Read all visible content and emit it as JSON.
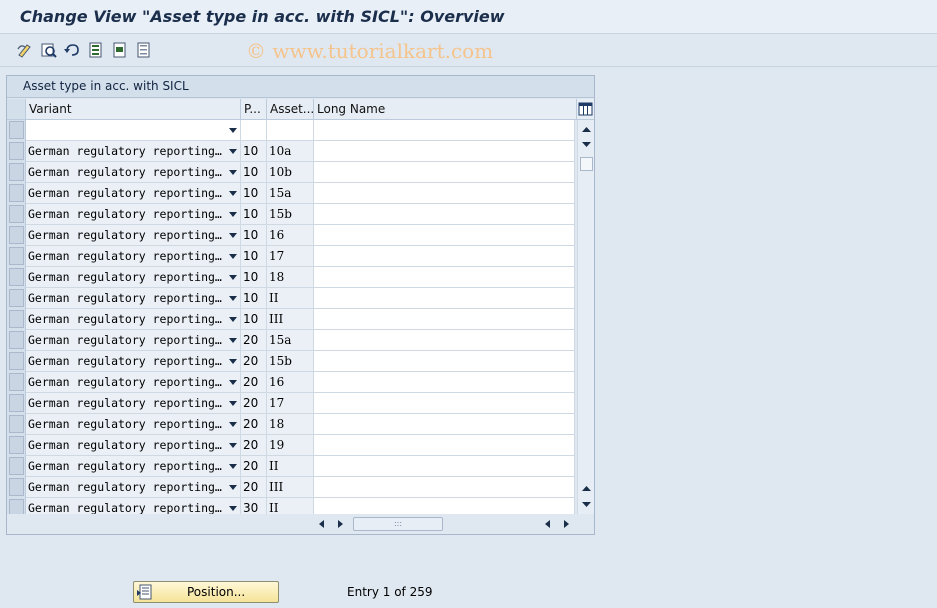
{
  "window": {
    "title": "Change View \"Asset type in acc. with SICL\": Overview"
  },
  "watermark": "© www.tutorialkart.com",
  "toolbar": {
    "icons": [
      "display-change-icon",
      "find-icon",
      "undo-icon",
      "select-all-icon",
      "select-block-icon",
      "deselect-all-icon"
    ]
  },
  "panel": {
    "title": "Asset type in acc. with SICL"
  },
  "table": {
    "columns": [
      "Variant",
      "P...",
      "Asset...",
      "Long Name"
    ],
    "rows": [
      {
        "variant": "German regulatory reporting…",
        "p": "10",
        "asset": "10a",
        "long": ""
      },
      {
        "variant": "German regulatory reporting…",
        "p": "10",
        "asset": "10b",
        "long": ""
      },
      {
        "variant": "German regulatory reporting…",
        "p": "10",
        "asset": "15a",
        "long": ""
      },
      {
        "variant": "German regulatory reporting…",
        "p": "10",
        "asset": "15b",
        "long": ""
      },
      {
        "variant": "German regulatory reporting…",
        "p": "10",
        "asset": "16",
        "long": ""
      },
      {
        "variant": "German regulatory reporting…",
        "p": "10",
        "asset": "17",
        "long": ""
      },
      {
        "variant": "German regulatory reporting…",
        "p": "10",
        "asset": "18",
        "long": ""
      },
      {
        "variant": "German regulatory reporting…",
        "p": "10",
        "asset": "II",
        "long": ""
      },
      {
        "variant": "German regulatory reporting…",
        "p": "10",
        "asset": "III",
        "long": ""
      },
      {
        "variant": "German regulatory reporting…",
        "p": "20",
        "asset": "15a",
        "long": ""
      },
      {
        "variant": "German regulatory reporting…",
        "p": "20",
        "asset": "15b",
        "long": ""
      },
      {
        "variant": "German regulatory reporting…",
        "p": "20",
        "asset": "16",
        "long": ""
      },
      {
        "variant": "German regulatory reporting…",
        "p": "20",
        "asset": "17",
        "long": ""
      },
      {
        "variant": "German regulatory reporting…",
        "p": "20",
        "asset": "18",
        "long": ""
      },
      {
        "variant": "German regulatory reporting…",
        "p": "20",
        "asset": "19",
        "long": ""
      },
      {
        "variant": "German regulatory reporting…",
        "p": "20",
        "asset": "II",
        "long": ""
      },
      {
        "variant": "German regulatory reporting…",
        "p": "20",
        "asset": "III",
        "long": ""
      },
      {
        "variant": "German regulatory reporting…",
        "p": "30",
        "asset": "II",
        "long": ""
      }
    ]
  },
  "footer": {
    "position_label": "Position...",
    "entry_text": "Entry 1 of 259"
  }
}
